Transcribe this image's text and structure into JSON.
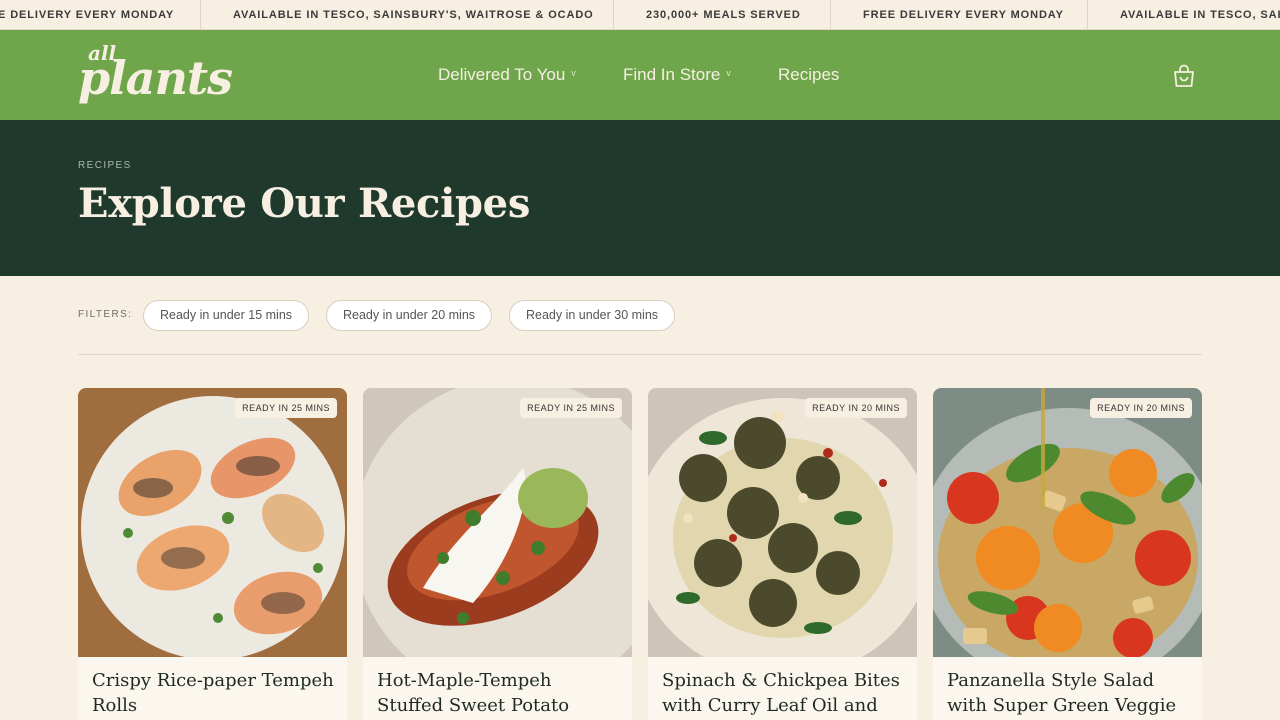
{
  "ticker": {
    "items": [
      "E DELIVERY EVERY MONDAY",
      "AVAILABLE IN TESCO, SAINSBURY'S, WAITROSE & OCADO",
      "230,000+ MEALS SERVED",
      "FREE DELIVERY EVERY MONDAY",
      "AVAILABLE IN TESCO, SAIN"
    ]
  },
  "header": {
    "logo_top": "all",
    "logo_bottom": "plants",
    "nav": [
      {
        "label": "Delivered To You",
        "caret": "v"
      },
      {
        "label": "Find In Store",
        "caret": "v"
      },
      {
        "label": "Recipes"
      }
    ],
    "cart_icon": "cart-icon"
  },
  "hero": {
    "breadcrumb": "RECIPES",
    "title": "Explore Our Recipes"
  },
  "filters": {
    "label": "FILTERS:",
    "chips": [
      "Ready in under 15 mins",
      "Ready in under 20 mins",
      "Ready in under 30 mins"
    ]
  },
  "recipes": [
    {
      "badge": "READY IN 25 MINS",
      "title": "Crispy Rice-paper Tempeh Rolls"
    },
    {
      "badge": "READY IN 25 MINS",
      "title": "Hot-Maple-Tempeh Stuffed Sweet Potato"
    },
    {
      "badge": "READY IN 20 MINS",
      "title": "Spinach & Chickpea Bites with Curry Leaf Oil and"
    },
    {
      "badge": "READY IN 20 MINS",
      "title": "Panzanella Style Salad with Super Green Veggie Tempeh"
    }
  ],
  "colors": {
    "header_green": "#6fa64b",
    "hero_dark_green": "#1f3a2c",
    "cream": "#f7efe2"
  }
}
